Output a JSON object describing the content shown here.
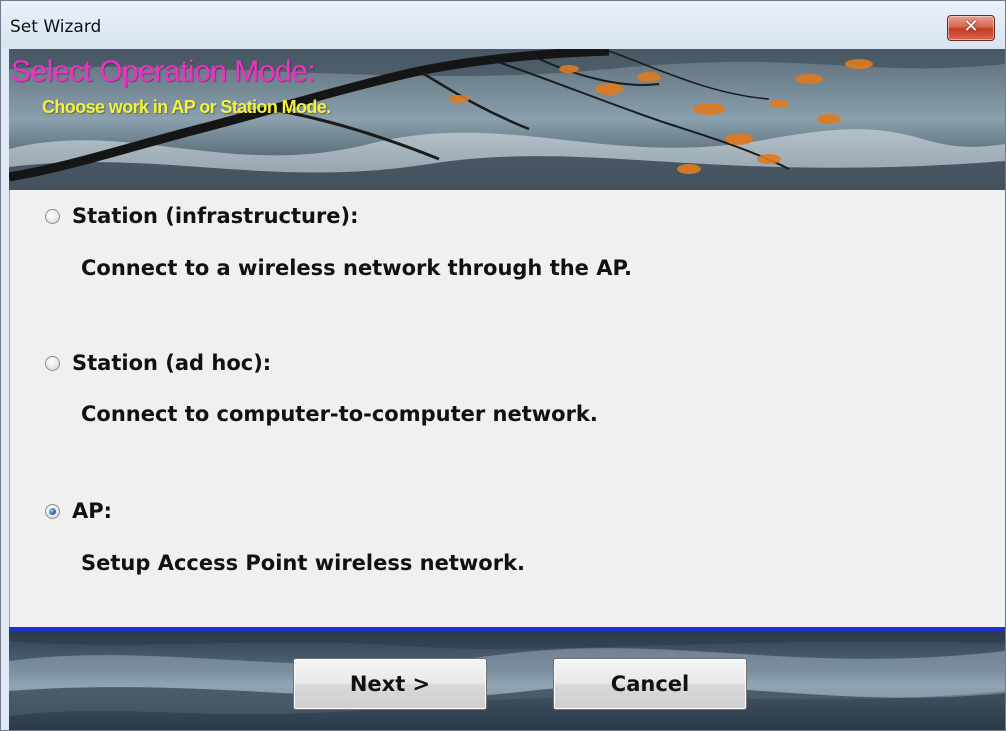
{
  "window": {
    "title": "Set Wizard",
    "close_symbol": "✕"
  },
  "banner": {
    "title": "Select Operation Mode:",
    "subtitle": "Choose work in AP or Station Mode."
  },
  "options": [
    {
      "label": "Station (infrastructure):",
      "description": "Connect to a wireless network through the AP.",
      "selected": false
    },
    {
      "label": "Station (ad hoc):",
      "description": "Connect to computer-to-computer network.",
      "selected": false
    },
    {
      "label": "AP:",
      "description": "Setup Access Point wireless network.",
      "selected": true
    }
  ],
  "buttons": {
    "next_label": "Next >",
    "cancel_label": "Cancel"
  },
  "colors": {
    "banner_title": "#f032c2",
    "banner_subtitle": "#f3f339",
    "divider": "#1d2fd3"
  }
}
